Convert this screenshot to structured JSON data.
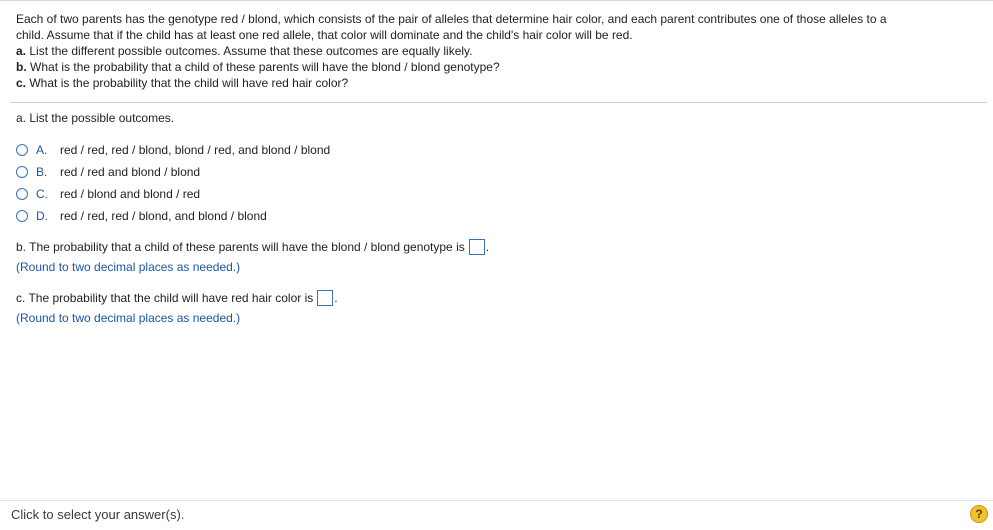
{
  "question": {
    "line1": "Each of two parents has the genotype red / blond, which consists of the pair of alleles that determine hair color, and each parent contributes one of those alleles to a",
    "line2": "child. Assume that if the child has at least one red allele, that color will dominate and the child's hair color will be red.",
    "a_prefix": "a.",
    "a_text": "List the different possible outcomes. Assume that these outcomes are equally likely.",
    "b_prefix": "b.",
    "b_text": "What is the probability that a child of these parents will have the blond / blond genotype?",
    "c_prefix": "c.",
    "c_text": "What is the probability that the child will have red hair color?"
  },
  "part_a": {
    "label": "a. List the possible outcomes.",
    "options": [
      {
        "letter": "A.",
        "text": "red / red, red / blond, blond / red, and blond / blond"
      },
      {
        "letter": "B.",
        "text": "red / red and blond / blond"
      },
      {
        "letter": "C.",
        "text": "red / blond and blond / red"
      },
      {
        "letter": "D.",
        "text": "red / red, red / blond, and blond / blond"
      }
    ]
  },
  "part_b": {
    "text": "b. The probability that a child of these parents will have the blond / blond genotype is",
    "period": ".",
    "hint": "(Round to two decimal places as needed.)"
  },
  "part_c": {
    "text": "c. The probability that the child will have red hair color is",
    "period": ".",
    "hint": "(Round to two decimal places as needed.)"
  },
  "footer": {
    "instruction": "Click to select your answer(s).",
    "help_symbol": "?"
  }
}
